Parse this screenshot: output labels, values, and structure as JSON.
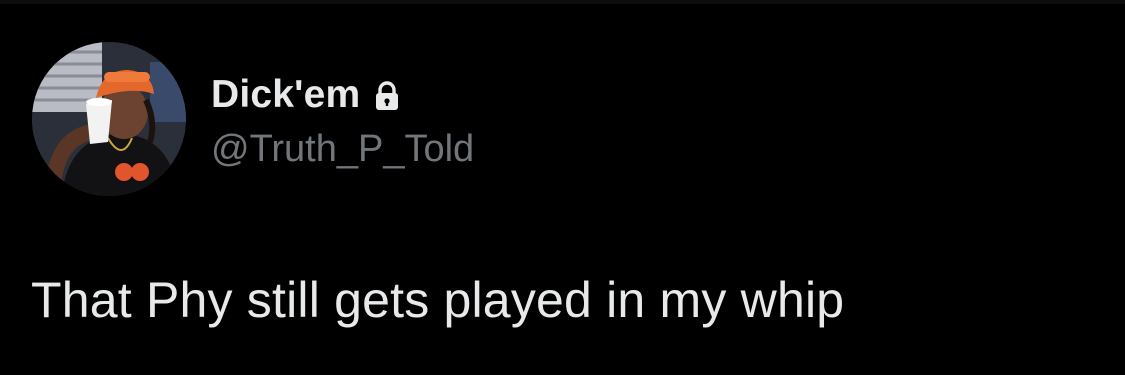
{
  "tweet": {
    "author": {
      "display_name": "Dick'em",
      "handle": "@Truth_P_Told",
      "protected_icon": "lock-icon",
      "avatar": "profile-photo"
    },
    "text": "That Phy still gets played in my whip"
  },
  "colors": {
    "background": "#000000",
    "primary_text": "#e7e9ea",
    "secondary_text": "#71767b"
  }
}
